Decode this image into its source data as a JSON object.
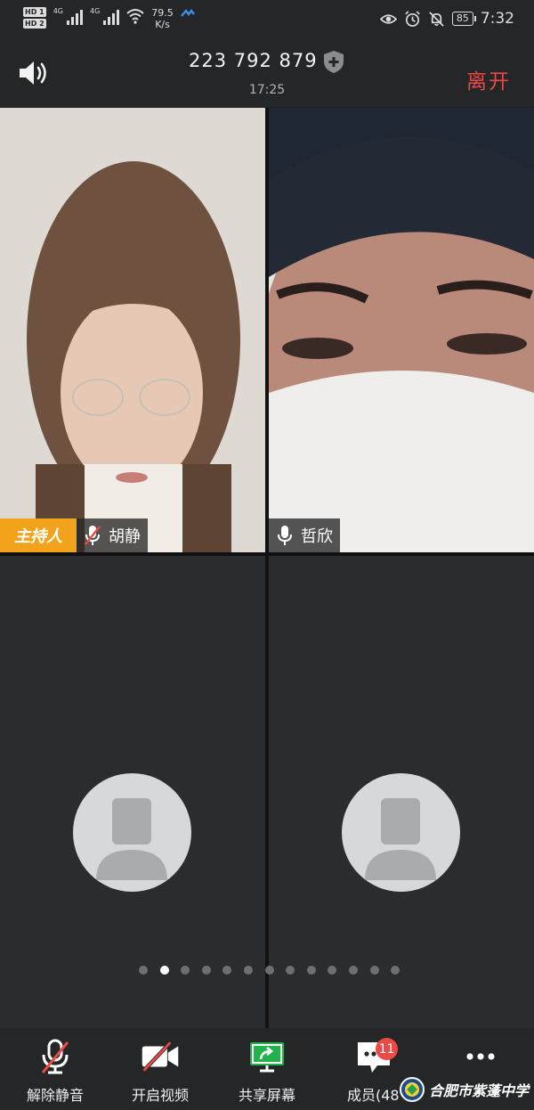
{
  "status_bar": {
    "hd_labels": [
      "HD 1",
      "HD 2"
    ],
    "net_labels": [
      "4G",
      "4G"
    ],
    "speed_value": "79.5",
    "speed_unit": "K/s",
    "battery": "85",
    "time": "7:32"
  },
  "header": {
    "meeting_id": "223 792 879",
    "duration": "17:25",
    "leave_label": "离开"
  },
  "participants": [
    {
      "name": "胡静",
      "role_tag": "主持人",
      "mic": "muted",
      "video": true
    },
    {
      "name": "哲欣",
      "mic": "on",
      "video": true
    },
    {
      "name": "",
      "video": false
    },
    {
      "name": "",
      "video": false
    }
  ],
  "pager": {
    "total": 13,
    "active_index": 1
  },
  "toolbar": {
    "unmute_label": "解除静音",
    "video_label": "开启视频",
    "share_label": "共享屏幕",
    "members_label": "成员(48",
    "members_badge": "11",
    "more_icon": "ellipsis-icon"
  },
  "watermark": {
    "text": "合肥市紫蓬中学"
  },
  "colors": {
    "leave": "#e94a45",
    "host_tag": "#f2a31b",
    "share_green": "#21b24c",
    "badge": "#e94a45"
  }
}
